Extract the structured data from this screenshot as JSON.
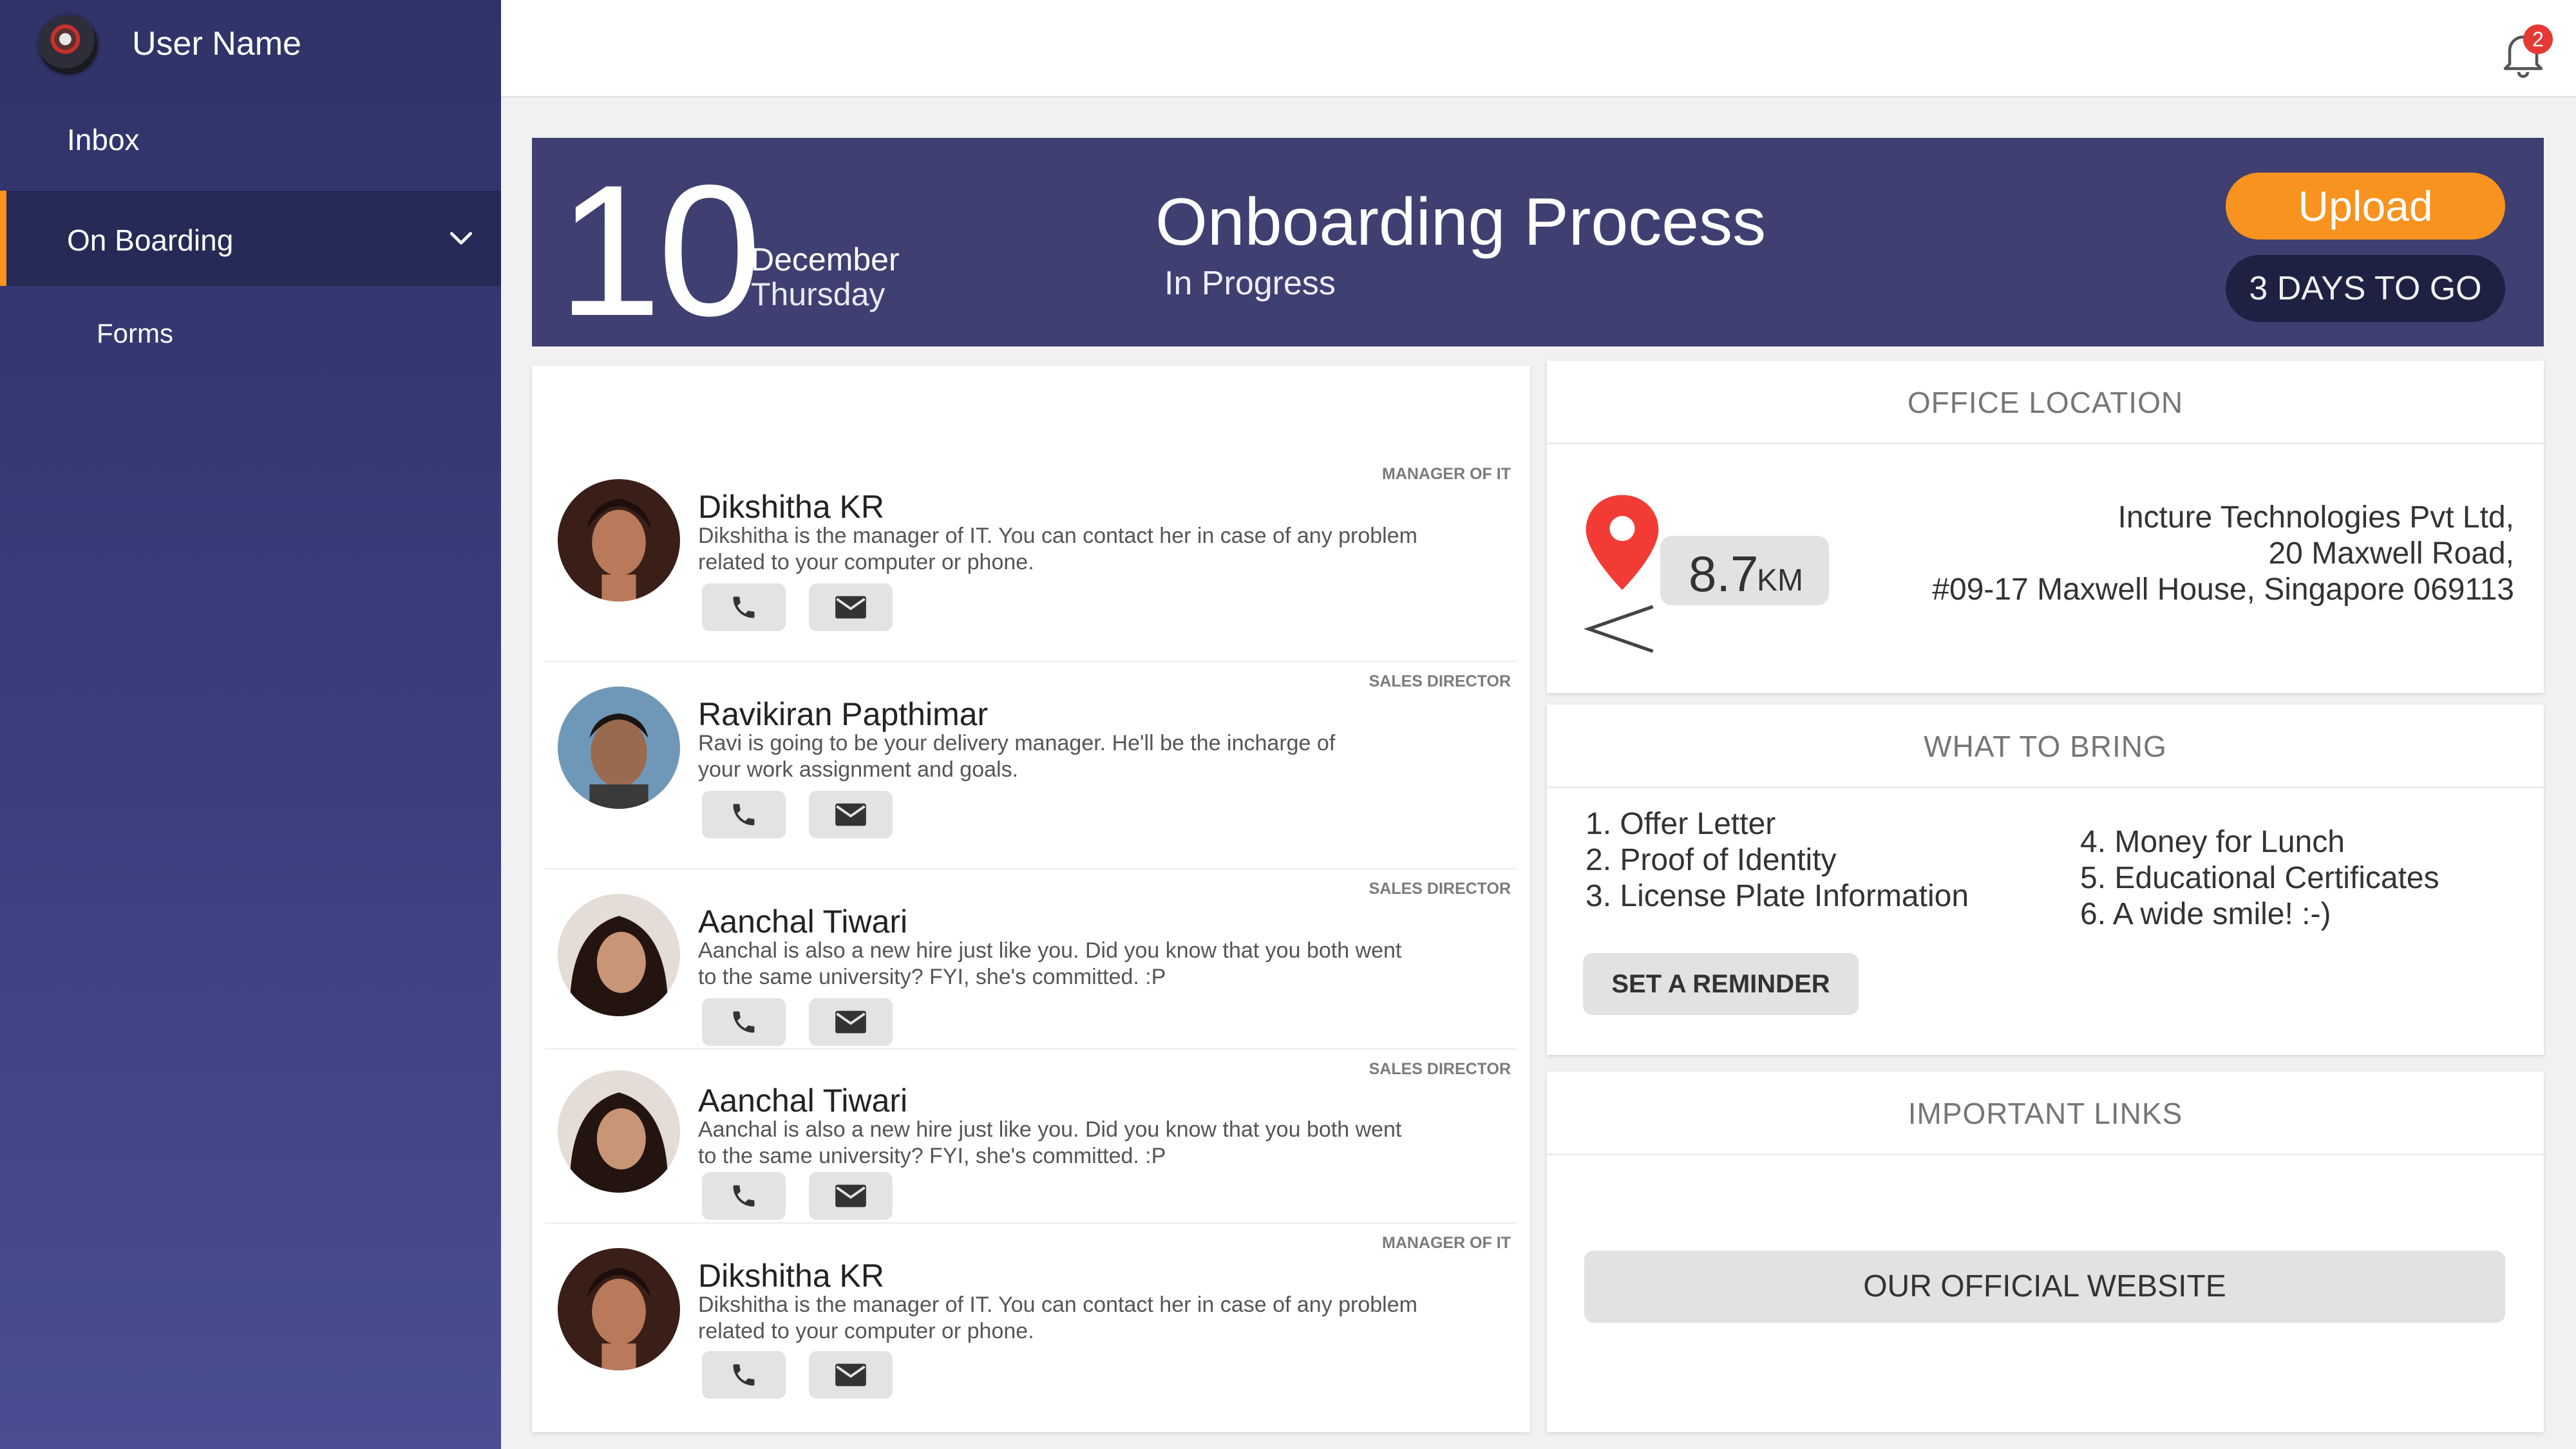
{
  "user": {
    "name": "User Name"
  },
  "sidebar": {
    "items": [
      {
        "label": "Inbox"
      },
      {
        "label": "On Boarding"
      },
      {
        "label": "Forms"
      }
    ]
  },
  "topbar": {
    "notification_count": "2"
  },
  "banner": {
    "day": "10",
    "month": "December",
    "weekday": "Thursday",
    "title": "Onboarding Process",
    "status": "In Progress",
    "upload_label": "Upload",
    "days_label": "3 DAYS TO GO"
  },
  "contacts": [
    {
      "role": "MANAGER OF IT",
      "name": "Dikshitha KR",
      "desc_1": "Dikshitha is the manager of IT. You can contact her in case of any problem",
      "desc_2": "related to your computer or phone."
    },
    {
      "role": "SALES DIRECTOR",
      "name": "Ravikiran Papthimar",
      "desc_1": "Ravi is going to be your delivery manager. He'll be the incharge of",
      "desc_2": "your work assignment and goals."
    },
    {
      "role": "SALES DIRECTOR",
      "name": "Aanchal Tiwari",
      "desc_1": "Aanchal is also a new hire just like you. Did you know that you both went",
      "desc_2": "to the same university? FYI, she's committed. :P"
    },
    {
      "role": "SALES DIRECTOR",
      "name": "Aanchal Tiwari",
      "desc_1": "Aanchal is also a new hire just like you. Did you know that you both went",
      "desc_2": "to the same university? FYI, she's committed. :P"
    },
    {
      "role": "MANAGER OF IT",
      "name": "Dikshitha KR",
      "desc_1": "Dikshitha is the manager of IT. You can contact her in case of any problem",
      "desc_2": "related to your computer or phone."
    }
  ],
  "office": {
    "heading": "OFFICE LOCATION",
    "distance": "8.7",
    "distance_unit": "KM",
    "address_1": "Incture Technologies Pvt Ltd,",
    "address_2": "20 Maxwell Road,",
    "address_3": "#09-17 Maxwell House, Singapore 069113"
  },
  "bring": {
    "heading": "WHAT TO BRING",
    "items": [
      "1. Offer Letter",
      "2. Proof of Identity",
      "3. License Plate Information",
      "4. Money for Lunch",
      "5. Educational Certificates",
      "6. A wide smile! :-)"
    ],
    "reminder_label": "SET A REMINDER"
  },
  "links": {
    "heading": "IMPORTANT LINKS",
    "website_label": "OUR OFFICIAL WEBSITE"
  },
  "colors": {
    "accent": "#f7931e",
    "banner": "#3f3f71",
    "sidebar": "#2f3367",
    "badge": "#e53935",
    "pin": "#f23b35"
  },
  "icons": [
    "chevron-down-icon",
    "bell-icon",
    "phone-icon",
    "mail-icon",
    "map-pin-icon"
  ]
}
